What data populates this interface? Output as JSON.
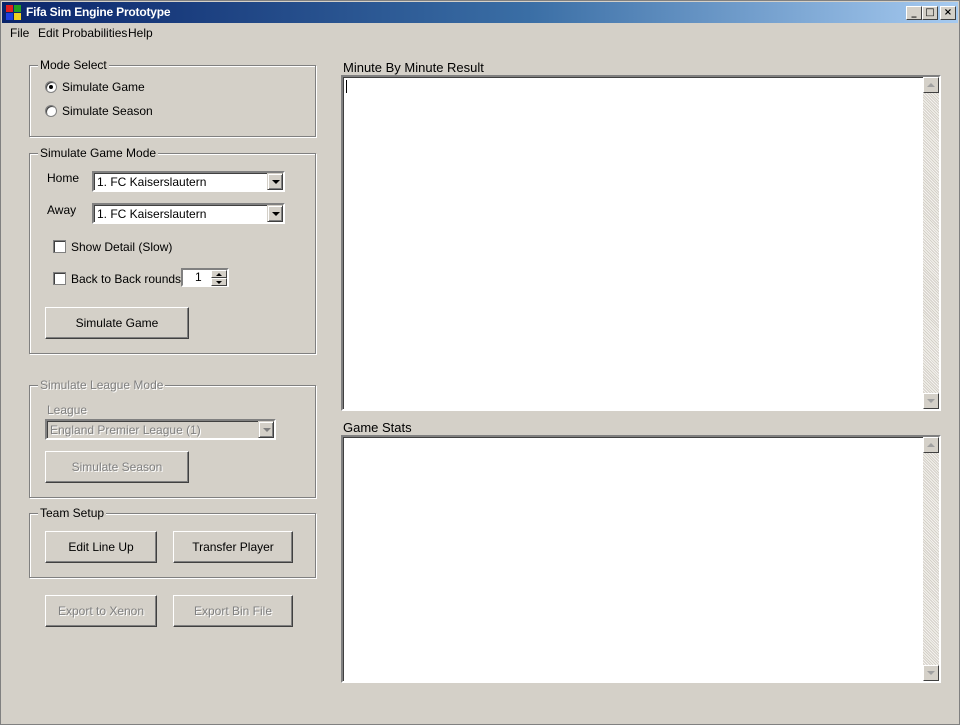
{
  "window": {
    "title": "Fifa Sim Engine Prototype",
    "controls": {
      "minimize": "_",
      "maximize": "□",
      "close": "×"
    }
  },
  "menu": {
    "items": [
      "File",
      "Edit Probabilities",
      "Help"
    ]
  },
  "mode_select": {
    "title": "Mode Select",
    "options": [
      {
        "label": "Simulate Game",
        "checked": true
      },
      {
        "label": "Simulate Season",
        "checked": false
      }
    ]
  },
  "game_mode": {
    "title": "Simulate Game Mode",
    "home_label": "Home",
    "home_value": "1. FC Kaiserslautern",
    "away_label": "Away",
    "away_value": "1. FC Kaiserslautern",
    "show_detail_label": "Show Detail (Slow)",
    "back_to_back_label": "Back to Back rounds",
    "rounds_value": "1",
    "simulate_button": "Simulate Game"
  },
  "league_mode": {
    "title": "Simulate League Mode",
    "league_label": "League",
    "league_value": "England Premier League (1)",
    "simulate_button": "Simulate Season"
  },
  "team_setup": {
    "title": "Team Setup",
    "edit_lineup_button": "Edit Line Up",
    "transfer_button": "Transfer Player"
  },
  "export": {
    "xenon_button": "Export to Xenon",
    "bin_button": "Export Bin File"
  },
  "results": {
    "minute_title": "Minute By Minute Result",
    "stats_title": "Game Stats"
  }
}
